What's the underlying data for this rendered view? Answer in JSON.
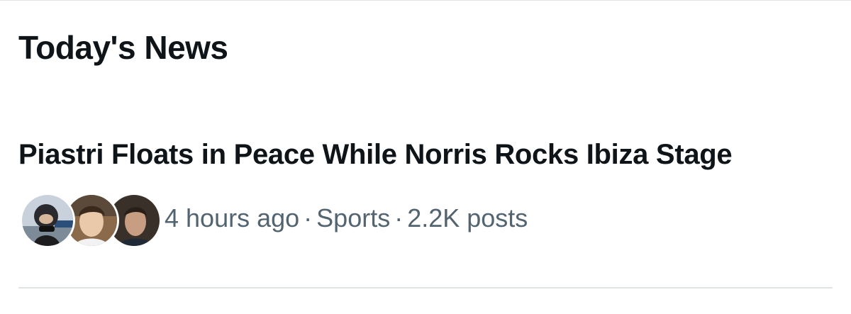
{
  "section": {
    "title": "Today's News"
  },
  "news": {
    "headline": "Piastri Floats in Peace While Norris Rocks Ibiza Stage",
    "time": "4 hours ago",
    "separator": "·",
    "category": "Sports",
    "posts": "2.2K posts"
  },
  "colors": {
    "text_primary": "#0f1419",
    "text_secondary": "#536471",
    "divider": "#e1e4e7"
  }
}
